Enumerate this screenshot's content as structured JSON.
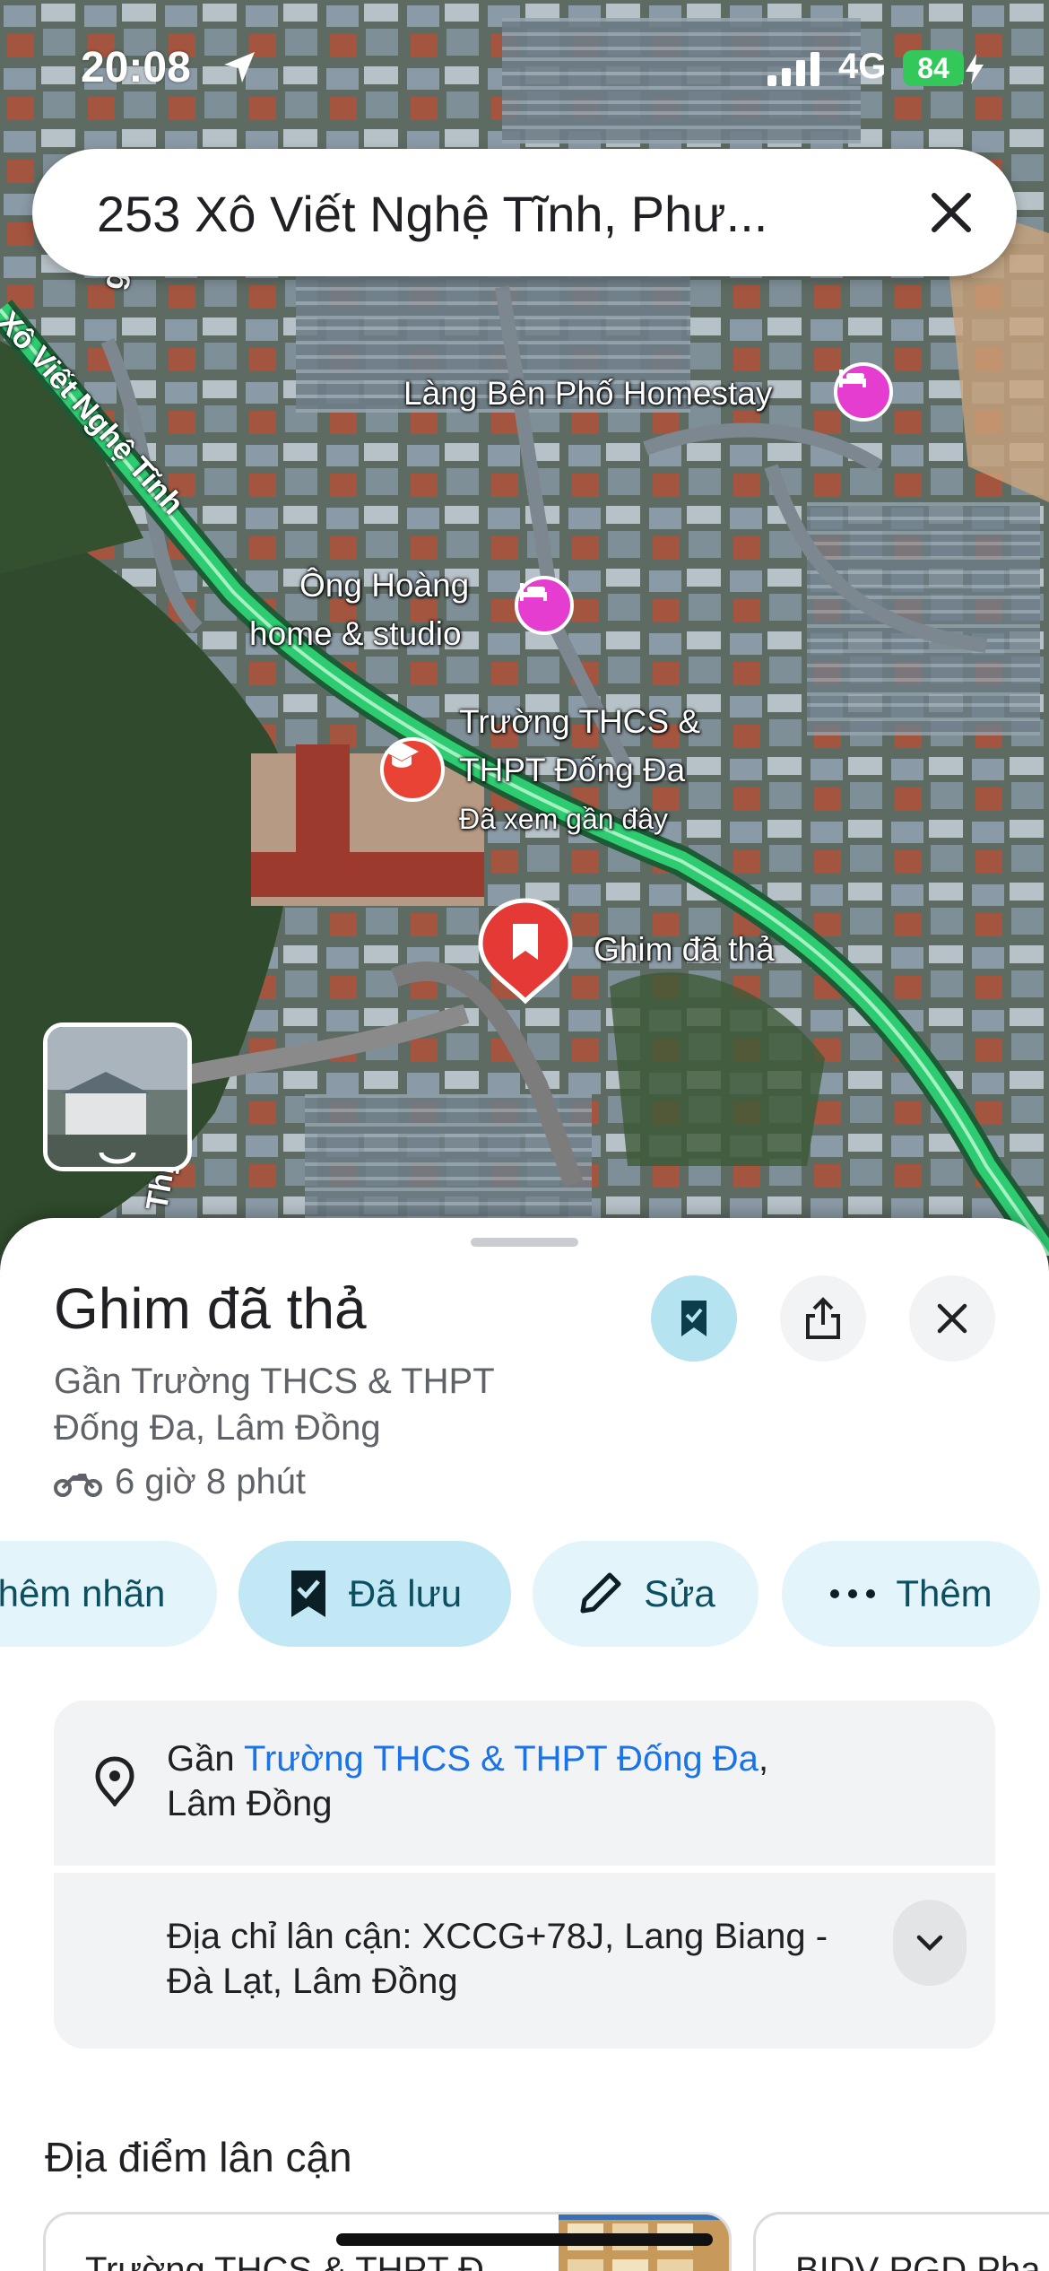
{
  "status_bar": {
    "time": "20:08",
    "network": "4G",
    "battery": "84"
  },
  "search": {
    "query": "253 Xô Viết Nghệ Tĩnh, Phư..."
  },
  "map": {
    "labels": {
      "road_main": "Xô Viết Nghệ Tĩnh",
      "road_side": "g Lâm",
      "road_bottom": "Thị",
      "homestay": "Làng Bên Phố Homestay",
      "studio_line1": "Ông Hoàng",
      "studio_line2": "home & studio",
      "school_line1": "Trường THCS &",
      "school_line2": "THPT Đống Đa",
      "school_note": "Đã xem gần đây",
      "pin": "Ghim đã thả"
    },
    "colors": {
      "lodging": "#e43dd0",
      "school": "#e84335",
      "pin": "#e53935",
      "route": "#2ecc71"
    }
  },
  "place": {
    "title": "Ghim đã thả",
    "subtitle": "Gần Trường THCS & THPT Đống Đa, Lâm Đồng",
    "eta": "6 giờ 8 phút"
  },
  "actions": {
    "label": "hêm nhãn",
    "saved": "Đã lưu",
    "edit": "Sửa",
    "more": "Thêm"
  },
  "details": {
    "near_prefix": "Gần ",
    "near_link": "Trường THCS & THPT Đống Đa",
    "near_suffix": ",",
    "near_region": "Lâm Đồng",
    "plus_code": "Địa chỉ lân cận: XCCG+78J, Lang Biang - Đà Lạt, Lâm Đồng"
  },
  "nearby": {
    "title": "Địa điểm lân cận",
    "items": [
      "Trường THCS & THPT Đ",
      "BIDV PGD Pha"
    ]
  }
}
